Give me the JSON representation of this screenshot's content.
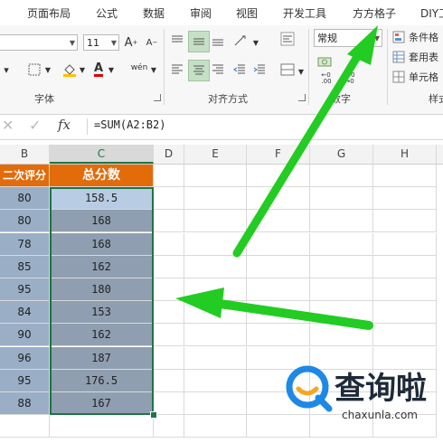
{
  "menu": {
    "items": [
      "页面布局",
      "公式",
      "数据",
      "审阅",
      "视图",
      "开发工具",
      "方方格子",
      "DIY工"
    ]
  },
  "ribbon": {
    "font_size": "11",
    "number_format": "常规",
    "group_labels": {
      "font": "字体",
      "alignment": "对齐方式",
      "number": "数字",
      "styles": "样式"
    },
    "style_buttons": {
      "conditional": "条件格",
      "table": "套用表",
      "cell": "单元格"
    },
    "icons": {
      "bold_a": "A",
      "font_grow": "A",
      "font_shrink": "A",
      "font_color": "A",
      "phonetic": "wén"
    }
  },
  "formula_bar": {
    "fx_label": "fx",
    "formula": "=SUM(A2:B2)"
  },
  "columns": [
    "B",
    "C",
    "D",
    "E",
    "F",
    "G",
    "H"
  ],
  "sheet": {
    "header_b": "二次评分",
    "header_c": "总分数",
    "b_values": [
      "80",
      "80",
      "78",
      "85",
      "95",
      "84",
      "90",
      "96",
      "95",
      "88"
    ],
    "c_values": [
      "158.5",
      "168",
      "168",
      "162",
      "180",
      "153",
      "162",
      "187",
      "176.5",
      "167"
    ]
  },
  "watermark": {
    "text": "查询啦",
    "url": "chaxunla.com"
  },
  "colors": {
    "accent_green": "#217346",
    "header_orange": "#e26b0a",
    "arrow_green": "#22cc22"
  }
}
